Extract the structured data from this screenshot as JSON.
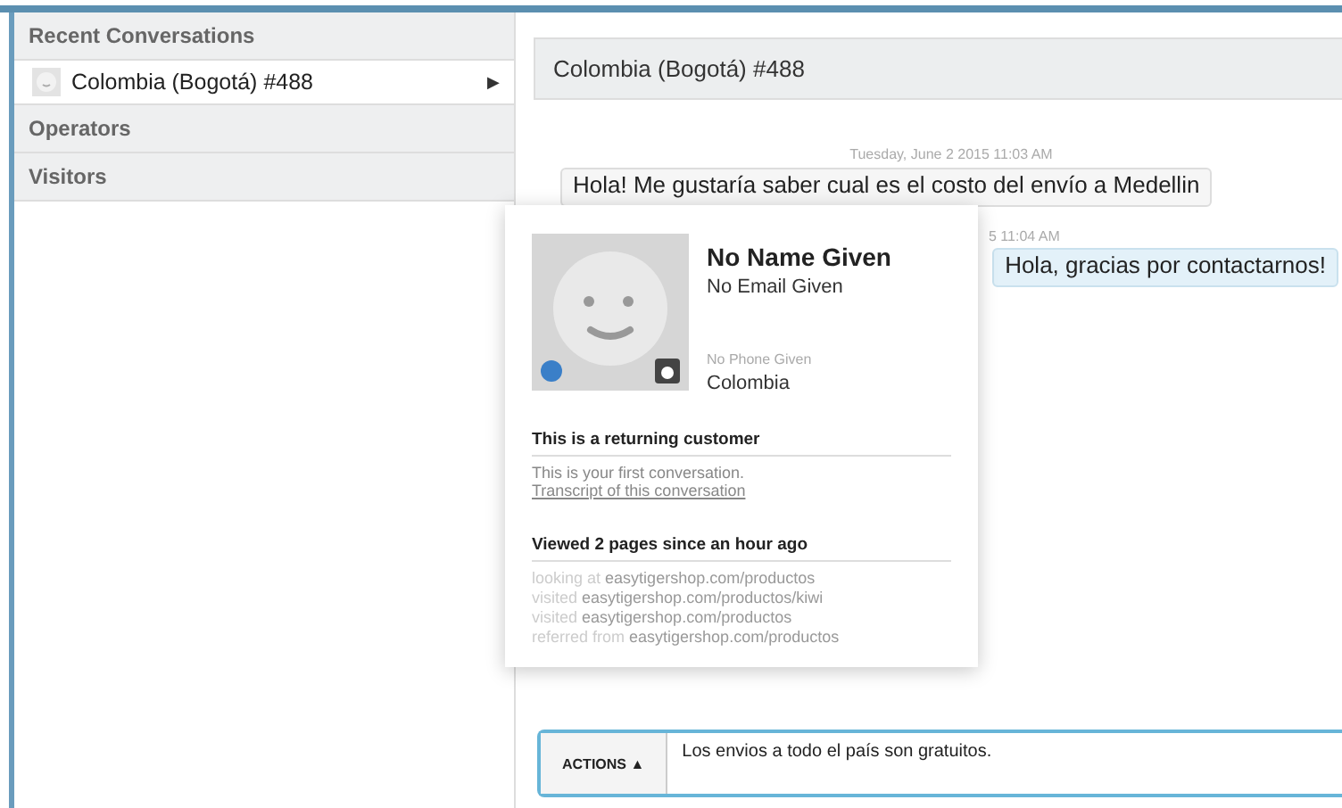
{
  "sidebar": {
    "sections": [
      {
        "title": "Recent Conversations",
        "items": [
          {
            "label": "Colombia (Bogotá) #488",
            "selected": true,
            "arrow": "▶"
          }
        ]
      },
      {
        "title": "Operators"
      },
      {
        "title": "Visitors"
      }
    ]
  },
  "conversation": {
    "title": "Colombia (Bogotá) #488",
    "messages": [
      {
        "timestamp": "Tuesday, June 2 2015 11:03 AM",
        "text": "Hola! Me gustaría saber cual es el costo del envío a Medellin",
        "kind": "visitor"
      },
      {
        "timestamp": "5 11:04 AM",
        "text": "Hola, gracias por contactarnos!",
        "kind": "operator"
      }
    ]
  },
  "visitor_card": {
    "name": "No Name Given",
    "email": "No Email Given",
    "phone": "No Phone Given",
    "country": "Colombia",
    "returning_title": "This is a returning customer",
    "returning_text": "This is your first conversation.",
    "transcript_link": "Transcript of this conversation",
    "pages_title": "Viewed 2 pages since an hour ago",
    "pages": [
      {
        "action": "looking at",
        "url": "easytigershop.com/productos"
      },
      {
        "action": "visited",
        "url": "easytigershop.com/productos/kiwi"
      },
      {
        "action": "visited",
        "url": "easytigershop.com/productos"
      },
      {
        "action": "referred from",
        "url": "easytigershop.com/productos"
      }
    ]
  },
  "composer": {
    "actions_label": "ACTIONS",
    "actions_caret": "▲",
    "value": "Los envios a todo el país son gratuitos."
  }
}
